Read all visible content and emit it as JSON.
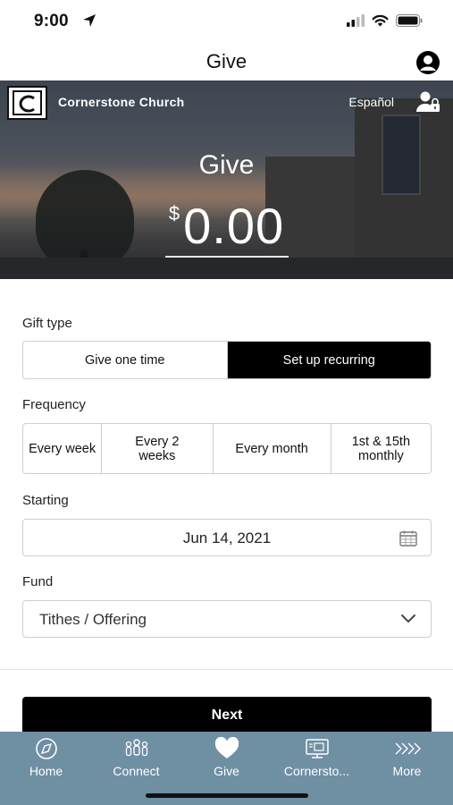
{
  "status_bar": {
    "time": "9:00"
  },
  "nav": {
    "title": "Give"
  },
  "hero": {
    "church_name": "Cornerstone Church",
    "language_link": "Español",
    "title": "Give",
    "currency_symbol": "$",
    "amount": "0.00"
  },
  "gift_type": {
    "label": "Gift type",
    "options": [
      "Give one time",
      "Set up recurring"
    ],
    "selected": "Set up recurring"
  },
  "frequency": {
    "label": "Frequency",
    "options": [
      "Every week",
      "Every 2 weeks",
      "Every month",
      "1st & 15th monthly"
    ]
  },
  "starting": {
    "label": "Starting",
    "value": "Jun 14, 2021"
  },
  "fund": {
    "label": "Fund",
    "value": "Tithes / Offering"
  },
  "next_button": {
    "label": "Next"
  },
  "tab_bar": {
    "items": [
      {
        "label": "Home",
        "icon": "compass-icon"
      },
      {
        "label": "Connect",
        "icon": "people-icon"
      },
      {
        "label": "Give",
        "icon": "heart-icon"
      },
      {
        "label": "Cornersto...",
        "icon": "screen-icon"
      },
      {
        "label": "More",
        "icon": "chevrons-icon"
      }
    ],
    "selected": "Give"
  },
  "colors": {
    "tab_bar_bg": "#6f8fa3",
    "selected_segment_bg": "#000000",
    "primary_button_bg": "#000000"
  }
}
